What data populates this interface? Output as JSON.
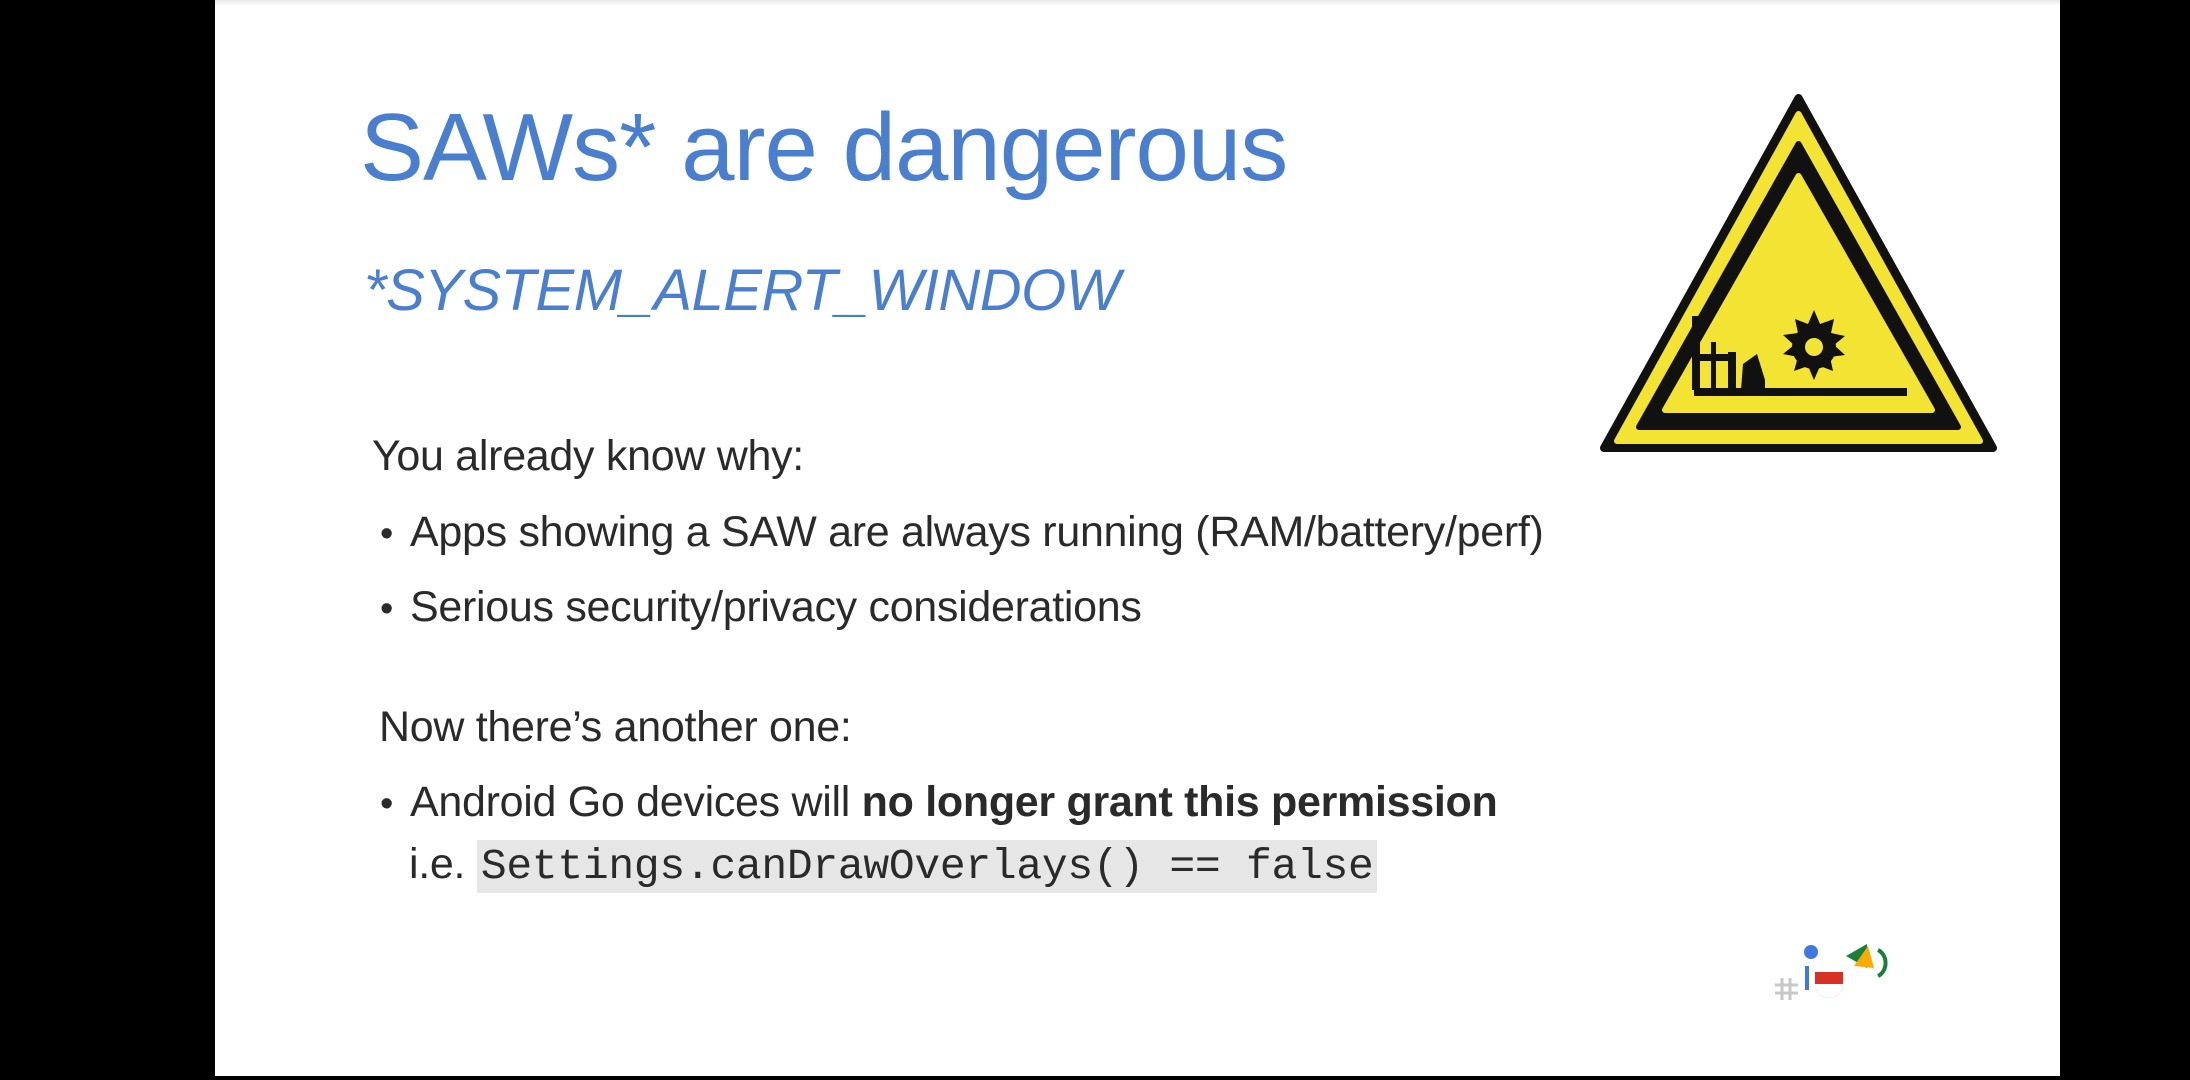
{
  "slide": {
    "title": "SAWs* are dangerous",
    "subtitle": "*SYSTEM_ALERT_WINDOW",
    "intro_1": "You already know why:",
    "bullet_1": "Apps showing a SAW are always running (RAM/battery/perf)",
    "bullet_2": "Serious security/privacy considerations",
    "intro_2": "Now there’s another one:",
    "bullet_3_plain": "Android Go devices will ",
    "bullet_3_bold": "no longer grant this permission",
    "ie_prefix": "i.e. ",
    "ie_code": "Settings.canDrawOverlays() == false",
    "bullet_char": "•"
  },
  "icons": {
    "warning": "machinery-hazard-warning-icon",
    "logo": "google-io-logo-icon"
  },
  "colors": {
    "title": "#4a7fcf",
    "body_text": "#2a2a2a",
    "warning_yellow": "#f3e332",
    "warning_black": "#111111",
    "code_background": "#e6e6e6"
  }
}
